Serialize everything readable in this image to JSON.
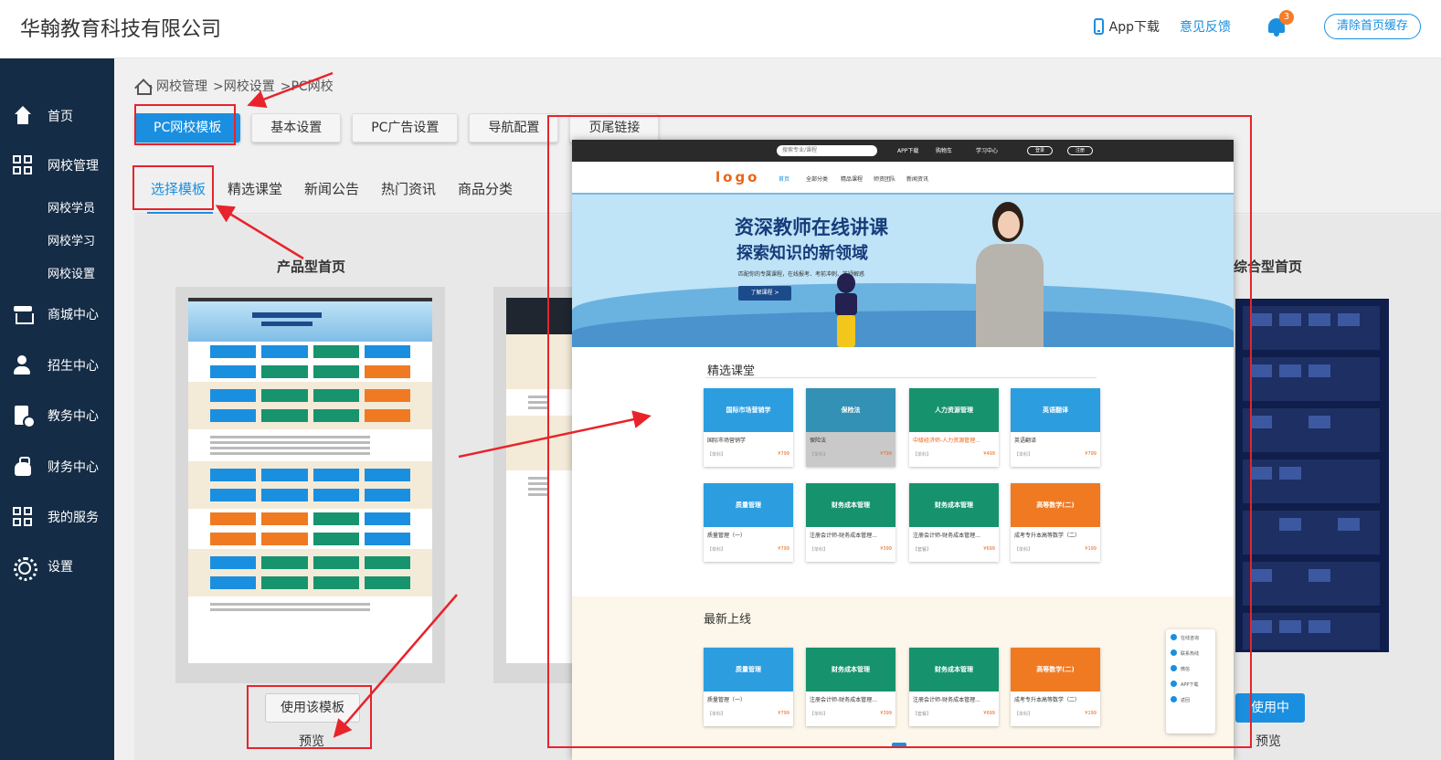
{
  "header": {
    "company": "华翰教育科技有限公司",
    "app_download": "App下载",
    "feedback": "意见反馈",
    "notification_count": "3",
    "clear_cache": "清除首页缓存"
  },
  "sidebar": {
    "items": [
      {
        "label": "首页",
        "icon": "home-icon"
      },
      {
        "label": "网校管理",
        "icon": "grid-icon"
      },
      {
        "label": "商城中心",
        "icon": "store-icon"
      },
      {
        "label": "招生中心",
        "icon": "person-icon"
      },
      {
        "label": "教务中心",
        "icon": "document-icon"
      },
      {
        "label": "财务中心",
        "icon": "money-bag-icon"
      },
      {
        "label": "我的服务",
        "icon": "grid-icon"
      },
      {
        "label": "设置",
        "icon": "gear-icon"
      }
    ],
    "subitems": [
      "网校学员",
      "网校学习",
      "网校设置"
    ]
  },
  "breadcrumb": {
    "items": [
      "网校管理",
      ">网校设置",
      ">PC网校"
    ]
  },
  "tabs": [
    "PC网校模板",
    "基本设置",
    "PC广告设置",
    "导航配置",
    "页尾链接"
  ],
  "subtabs": [
    "选择模板",
    "精选课堂",
    "新闻公告",
    "热门资讯",
    "商品分类"
  ],
  "templates": {
    "product_title": "产品型首页",
    "composite_title": "综合型首页",
    "use_template": "使用该模板",
    "in_use": "使用中",
    "preview": "预览"
  },
  "preview": {
    "search_placeholder": "搜索专业/课程",
    "top_links": [
      "APP下载",
      "购物车",
      "学习中心",
      "登录",
      "注册"
    ],
    "logo": "logo",
    "nav": [
      "首页",
      "全部分类",
      "精品课程",
      "师资团队",
      "新闻资讯"
    ],
    "banner_title": "资深教师在线讲课",
    "banner_subtitle": "探索知识的新领域",
    "banner_desc": "匹配你的专属课程，在线报考、考前冲刺、答疑解惑",
    "banner_button": "了解课程 >",
    "section_featured": "精选课堂",
    "section_latest": "最新上线",
    "featured_row1": [
      {
        "img": "国际市场营销学",
        "name": "国际市场营销学",
        "tag": "【单科】",
        "price": "¥799",
        "color": "blue"
      },
      {
        "img": "保险法",
        "name": "保险法",
        "tag": "【单科】",
        "price": "¥799",
        "color": "teal"
      },
      {
        "img": "人力资源管理",
        "name": "中级经济师-人力资源管理...",
        "tag": "【单科】",
        "price": "¥499",
        "color": "green"
      },
      {
        "img": "英语翻译",
        "name": "英语翻译",
        "tag": "【单科】",
        "price": "¥799",
        "color": "blue"
      }
    ],
    "featured_row2": [
      {
        "img": "质量管理",
        "name": "质量管理（一）",
        "tag": "【单科】",
        "price": "¥799",
        "color": "blue"
      },
      {
        "img": "财务成本管理",
        "name": "注册会计师-财务成本管理...",
        "tag": "【单科】",
        "price": "¥399",
        "color": "green"
      },
      {
        "img": "财务成本管理",
        "name": "注册会计师-财务成本管理...",
        "tag": "【套餐】",
        "price": "¥699",
        "color": "green"
      },
      {
        "img": "高等数学(二)",
        "name": "成考专升本高等数学（二）",
        "tag": "【单科】",
        "price": "¥199",
        "color": "orange"
      }
    ],
    "latest_row": [
      {
        "img": "质量管理",
        "name": "质量管理（一）",
        "tag": "【单科】",
        "price": "¥799",
        "color": "blue"
      },
      {
        "img": "财务成本管理",
        "name": "注册会计师-财务成本管理...",
        "tag": "【单科】",
        "price": "¥399",
        "color": "green"
      },
      {
        "img": "财务成本管理",
        "name": "注册会计师-财务成本管理...",
        "tag": "【套餐】",
        "price": "¥699",
        "color": "green"
      },
      {
        "img": "高等数学(二)",
        "name": "成考专升本高等数学（二）",
        "tag": "【单科】",
        "price": "¥199",
        "color": "orange"
      }
    ],
    "float_menu": [
      "在线咨询",
      "联系热线",
      "微信",
      "APP下载",
      "返回"
    ]
  },
  "colors": {
    "accent": "#1a8fe0",
    "sidebar": "#142c46",
    "annotation": "#e8232b",
    "badge": "#f57c28"
  }
}
